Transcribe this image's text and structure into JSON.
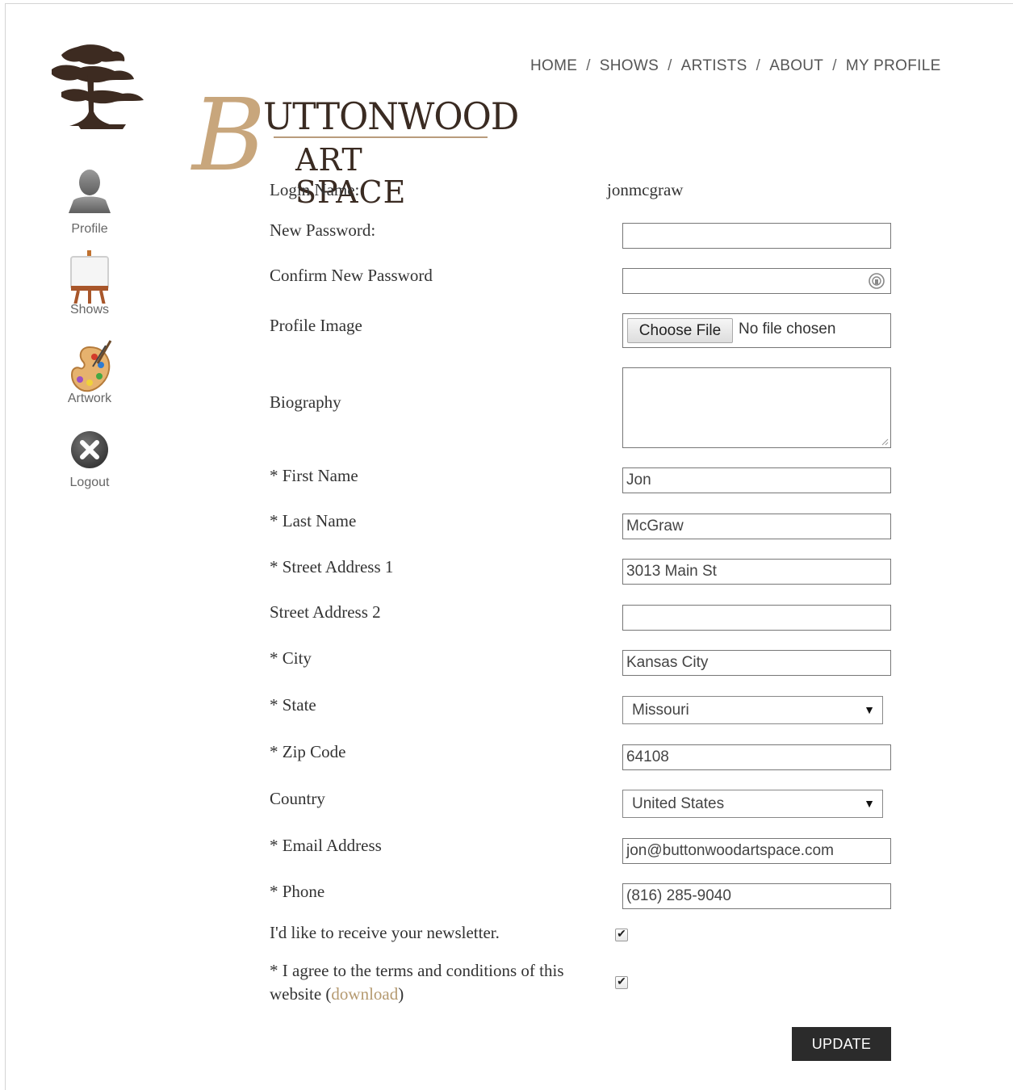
{
  "logo": {
    "letter": "B",
    "word": "UTTONWOOD",
    "sub": "ART SPACE"
  },
  "nav": {
    "items": [
      "HOME",
      "SHOWS",
      "ARTISTS",
      "ABOUT",
      "MY PROFILE"
    ],
    "separator": "/"
  },
  "sidebar": {
    "items": [
      {
        "label": "Profile",
        "icon": "user-icon"
      },
      {
        "label": "Shows",
        "icon": "easel-icon"
      },
      {
        "label": "Artwork",
        "icon": "palette-icon"
      },
      {
        "label": "Logout",
        "icon": "close-icon"
      }
    ]
  },
  "form": {
    "login_label": "Login Name:",
    "login_value": "jonmcgraw",
    "new_password_label": "New Password:",
    "confirm_password_label": "Confirm New Password",
    "profile_image_label": "Profile Image",
    "file_button": "Choose File",
    "file_status": "No file chosen",
    "biography_label": "Biography",
    "first_name_label": "* First Name",
    "first_name": "Jon",
    "last_name_label": "* Last Name",
    "last_name": "McGraw",
    "street1_label": "* Street Address 1",
    "street1": "3013 Main St",
    "street2_label": "Street Address 2",
    "street2": "",
    "city_label": "* City",
    "city": "Kansas City",
    "state_label": "* State",
    "state": "Missouri",
    "zip_label": "* Zip Code",
    "zip": "64108",
    "country_label": "Country",
    "country": "United States",
    "email_label": "* Email Address",
    "email": "jon@buttonwoodartspace.com",
    "phone_label": "* Phone",
    "phone": "(816) 285-9040",
    "newsletter_label": "I'd like to receive your newsletter.",
    "newsletter_checked": true,
    "terms_text": "* I agree to the terms and conditions of this website (",
    "terms_link": "download",
    "terms_close": ")",
    "terms_checked": true,
    "update_button": "UPDATE"
  }
}
